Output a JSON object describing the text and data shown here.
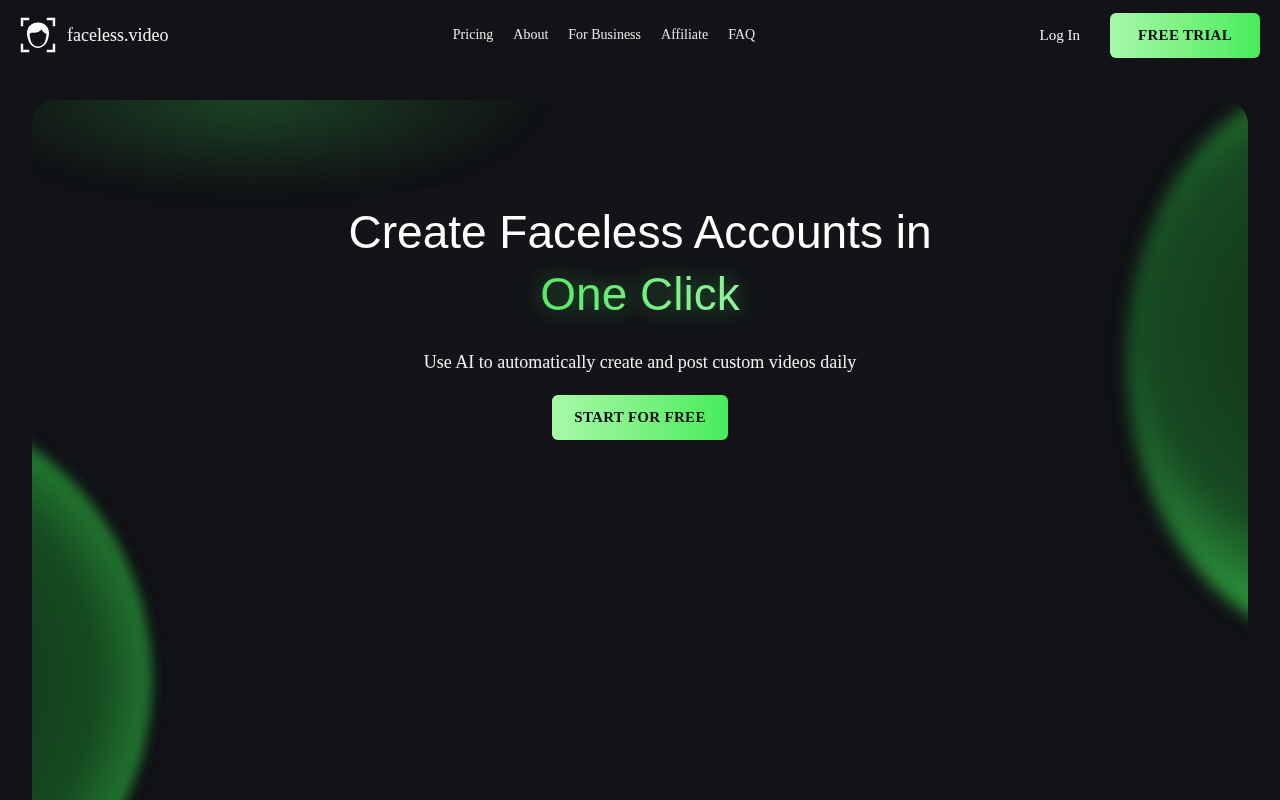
{
  "header": {
    "logo": {
      "text": "faceless.video"
    },
    "nav": [
      {
        "label": "Pricing"
      },
      {
        "label": "About"
      },
      {
        "label": "For Business"
      },
      {
        "label": "Affiliate"
      },
      {
        "label": "FAQ"
      }
    ],
    "login": {
      "label": "Log In"
    },
    "cta": {
      "label": "FREE TRIAL"
    }
  },
  "hero": {
    "title": "Create Faceless Accounts in",
    "highlight": "One Click",
    "subtitle": "Use AI to automatically create and post custom videos daily",
    "button": {
      "label": "START FOR FREE"
    }
  }
}
